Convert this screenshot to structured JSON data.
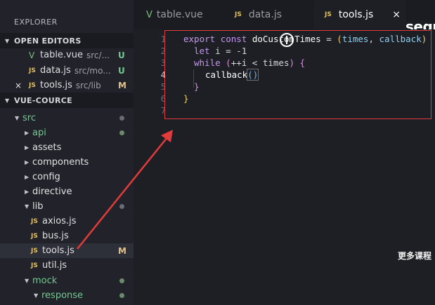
{
  "sidebar": {
    "title": "EXPLORER",
    "open_editors_header": "OPEN EDITORS",
    "project_header": "VUE-COURCE",
    "open_editors": [
      {
        "icon": "vue-icon",
        "name": "table.vue",
        "path": "src/...",
        "status": "U"
      },
      {
        "icon": "js-icon",
        "name": "data.js",
        "path": "src/mo...",
        "status": "U"
      },
      {
        "icon": "js-icon",
        "name": "tools.js",
        "path": "src/lib",
        "status": "M"
      }
    ],
    "tree": {
      "src": "src",
      "api": "api",
      "assets": "assets",
      "components": "components",
      "config": "config",
      "directive": "directive",
      "lib": "lib",
      "axios": "axios.js",
      "bus": "bus.js",
      "tools": "tools.js",
      "tools_status": "M",
      "util": "util.js",
      "mock": "mock",
      "response": "response"
    },
    "js_glyph": "JS",
    "vue_glyph": "V",
    "close_glyph": "×"
  },
  "tabs": [
    {
      "label": "table.vue",
      "icon": "vue-icon",
      "active": false
    },
    {
      "label": "data.js",
      "icon": "js-icon",
      "active": false
    },
    {
      "label": "tools.js",
      "icon": "js-icon",
      "active": true
    }
  ],
  "tab_close_glyph": "×",
  "brand": "segr",
  "editor": {
    "line_numbers": [
      "1",
      "2",
      "3",
      "4",
      "5",
      "6",
      "7"
    ],
    "current_line": "4",
    "code": {
      "l1_export": "export",
      "l1_const": "const",
      "l1_name": "doCustomTimes",
      "l1_eq": " = ",
      "l1_open": "(",
      "l1_p1": "times",
      "l1_comma": ", ",
      "l1_p2": "callback",
      "l1_close": ")",
      "l2_let": "let",
      "l2_rest": " i = -1",
      "l3_while": "while",
      "l3_open": " (",
      "l3_cond": "++i < times",
      "l3_close": ")",
      "l3_brace": " {",
      "l4_call": "callback",
      "l4_parens": "()",
      "l5_brace": "}",
      "l6_brace": "}"
    }
  },
  "watermark": "更多课程",
  "colors": {
    "annotation": "#e23b3b",
    "accent_vue": "#79c27a",
    "accent_js": "#e5c15a",
    "status_untracked": "#73c991",
    "status_modified": "#e2c08d"
  }
}
